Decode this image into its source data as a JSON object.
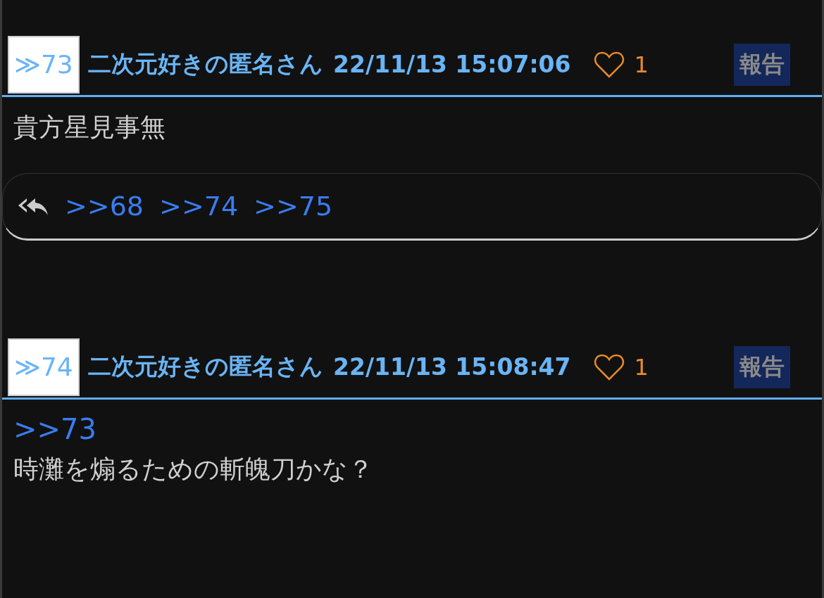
{
  "posts": [
    {
      "number": "≫73",
      "name": "二次元好きの匿名さん",
      "date": "22/11/13 15:07:06",
      "likes": "1",
      "report": "報告",
      "body": [
        {
          "kind": "text",
          "text": "貴方星見事無"
        }
      ],
      "replies": [
        ">>68",
        ">>74",
        ">>75"
      ]
    },
    {
      "number": "≫74",
      "name": "二次元好きの匿名さん",
      "date": "22/11/13 15:08:47",
      "likes": "1",
      "report": "報告",
      "body": [
        {
          "kind": "link",
          "text": ">>73"
        },
        {
          "kind": "text",
          "text": "時灘を煽るための斬魄刀かな？"
        }
      ]
    }
  ]
}
